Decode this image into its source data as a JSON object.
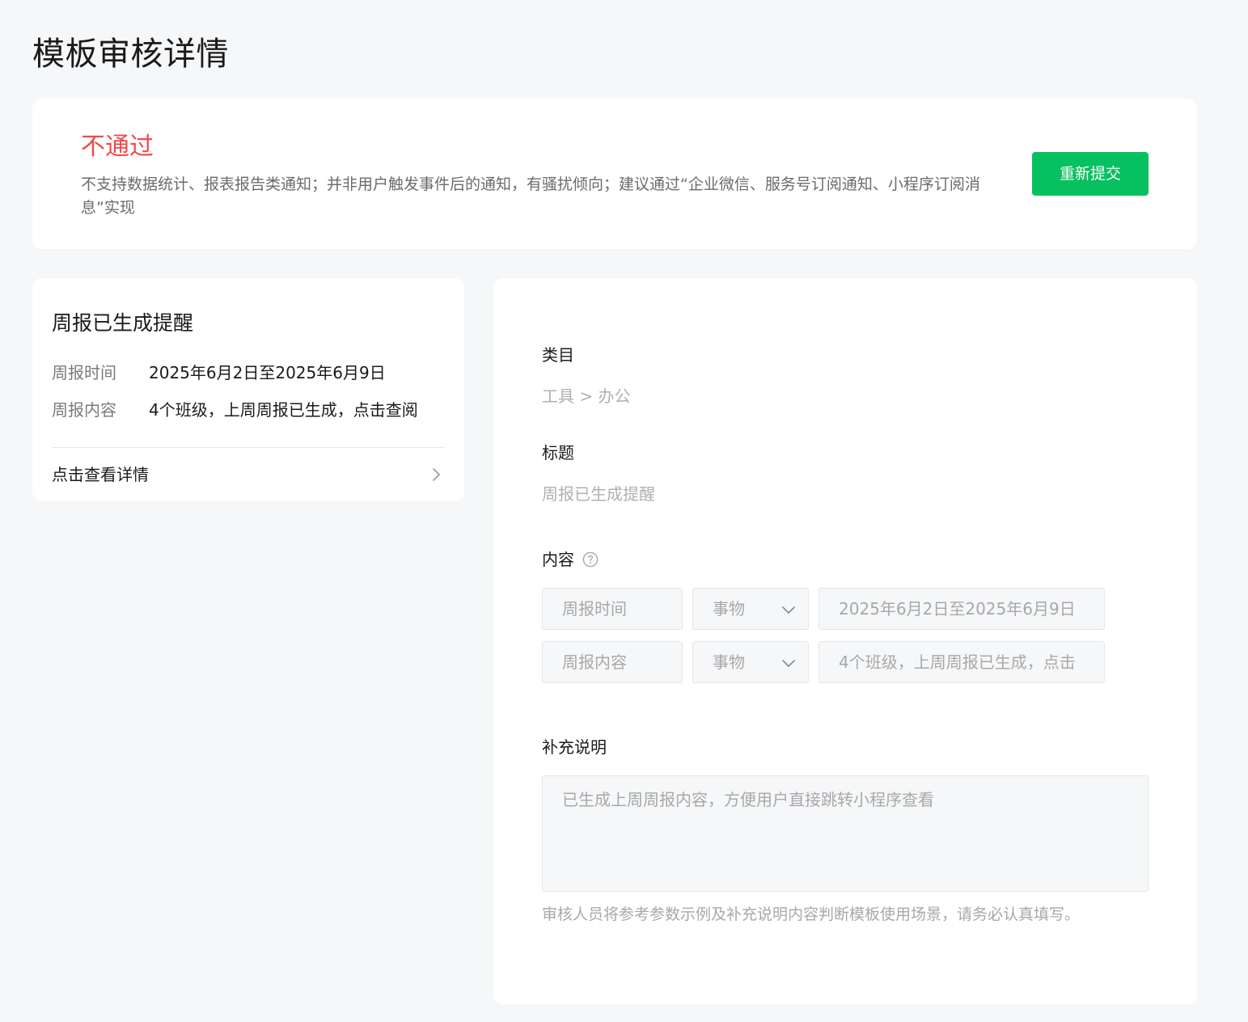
{
  "page": {
    "title": "模板审核详情"
  },
  "status": {
    "title": "不通过",
    "reason": "不支持数据统计、报表报告类通知；并非用户触发事件后的通知，有骚扰倾向；建议通过“企业微信、服务号订阅通知、小程序订阅消息”实现",
    "resubmit_label": "重新提交",
    "accent_color": "#f04a4a",
    "button_color": "#07c160"
  },
  "preview": {
    "title": "周报已生成提醒",
    "rows": [
      {
        "label": "周报时间",
        "value": "2025年6月2日至2025年6月9日"
      },
      {
        "label": "周报内容",
        "value": "4个班级，上周周报已生成，点击查阅"
      }
    ],
    "detail_link": "点击查看详情",
    "chevron_icon": "chevron-right-icon"
  },
  "form": {
    "category_label": "类目",
    "category_value": "工具 > 办公",
    "title_label": "标题",
    "title_value": "周报已生成提醒",
    "content_label": "内容",
    "help_icon": "question-circle-icon",
    "content_rows": [
      {
        "name": "周报时间",
        "type": "事物",
        "example": "2025年6月2日至2025年6月9日"
      },
      {
        "name": "周报内容",
        "type": "事物",
        "example": "4个班级，上周周报已生成，点击"
      }
    ],
    "supplement_label": "补充说明",
    "supplement_value": "已生成上周周报内容，方便用户直接跳转小程序查看",
    "hint": "审核人员将参考参数示例及补充说明内容判断模板使用场景，请务必认真填写。"
  }
}
